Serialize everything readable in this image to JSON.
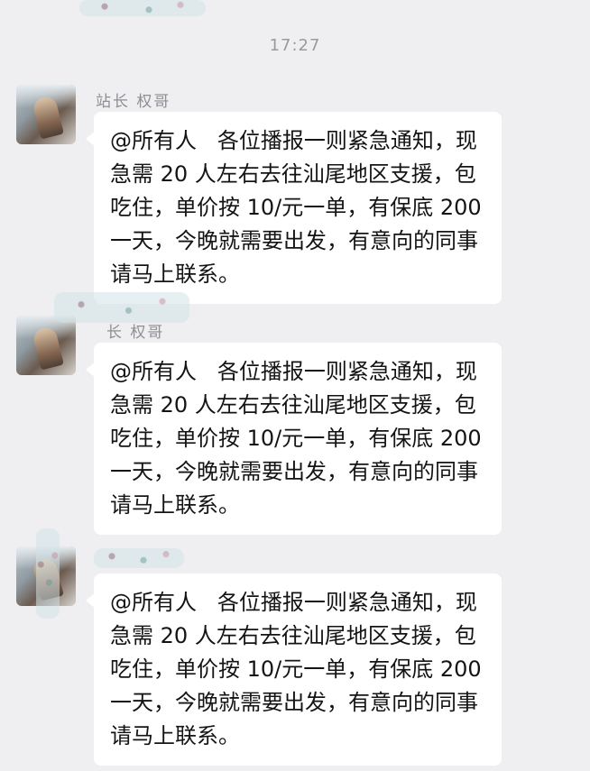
{
  "chat": {
    "timestamp": "17:27",
    "messages": [
      {
        "sender": "站长  权哥",
        "text": "@所有人   各位播报一则紧急通知，现急需 20 人左右去往汕尾地区支援，包吃住，单价按 10/元一单，有保底 200 一天，今晚就需要出发，有意向的同事请马上联系。"
      },
      {
        "sender": "长  权哥",
        "text": "@所有人   各位播报一则紧急通知，现急需 20 人左右去往汕尾地区支援，包吃住，单价按 10/元一单，有保底 200 一天，今晚就需要出发，有意向的同事请马上联系。"
      },
      {
        "sender": "",
        "text": "@所有人   各位播报一则紧急通知，现急需 20 人左右去往汕尾地区支援，包吃住，单价按 10/元一单，有保底 200 一天，今晚就需要出发，有意向的同事请马上联系。"
      }
    ]
  }
}
